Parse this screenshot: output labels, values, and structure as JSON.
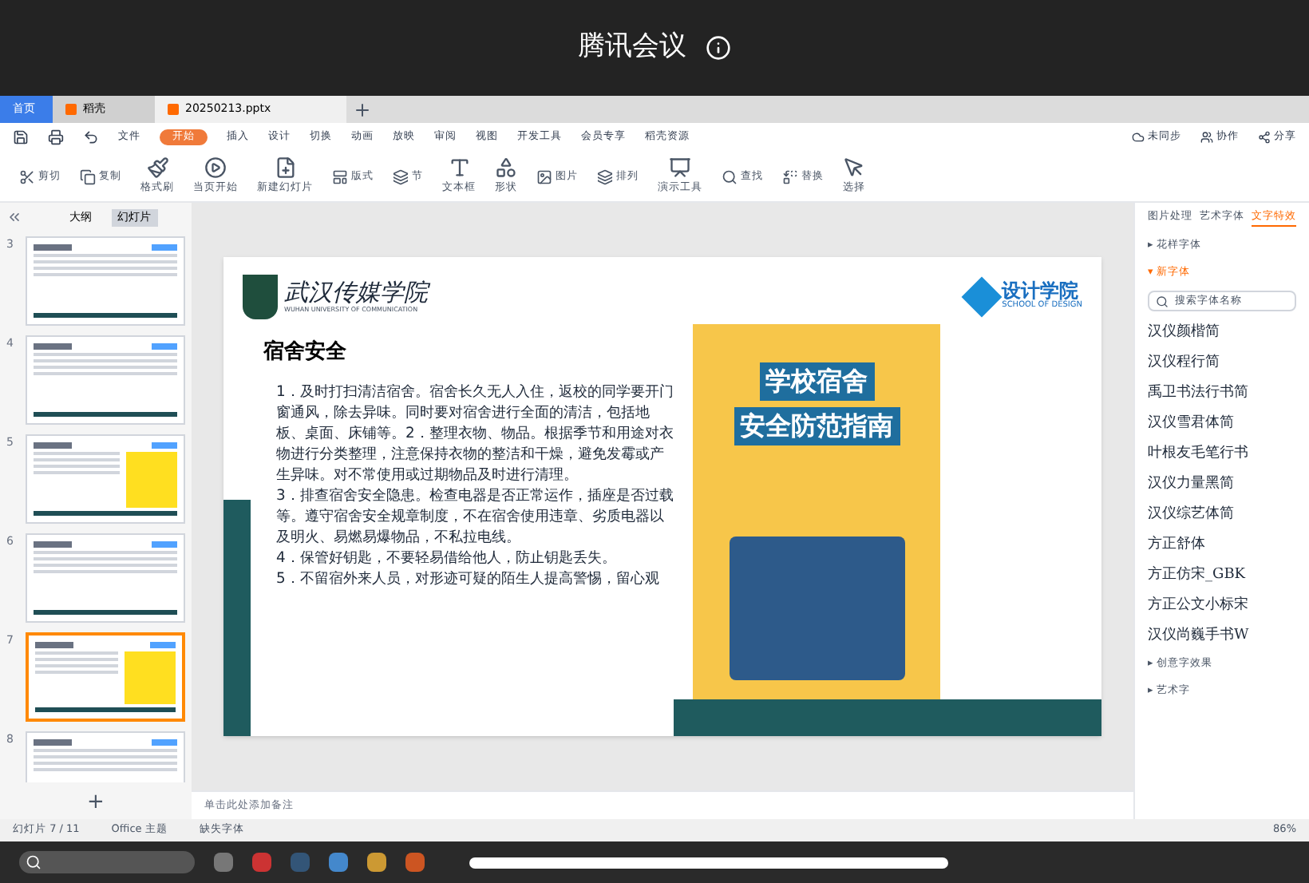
{
  "meeting": {
    "title": "腾讯会议"
  },
  "tabs": [
    {
      "label": "首页",
      "kind": "home",
      "selected": false
    },
    {
      "label": "稻壳",
      "kind": "doc",
      "selected": false
    },
    {
      "label": "20250213.pptx",
      "kind": "doc",
      "selected": true
    }
  ],
  "menu": [
    {
      "label": "文件",
      "selected": false
    },
    {
      "label": "开始",
      "selected": true
    },
    {
      "label": "插入",
      "selected": false
    },
    {
      "label": "设计",
      "selected": false
    },
    {
      "label": "切换",
      "selected": false
    },
    {
      "label": "动画",
      "selected": false
    },
    {
      "label": "放映",
      "selected": false
    },
    {
      "label": "审阅",
      "selected": false
    },
    {
      "label": "视图",
      "selected": false
    },
    {
      "label": "开发工具",
      "selected": false
    },
    {
      "label": "会员专享",
      "selected": false
    },
    {
      "label": "稻壳资源",
      "selected": false
    }
  ],
  "menu_right": [
    "未同步",
    "协作",
    "分享"
  ],
  "toolbar": [
    {
      "label": "剪切",
      "kind": "small"
    },
    {
      "label": "复制",
      "kind": "small"
    },
    {
      "label": "格式刷",
      "kind": "big"
    },
    {
      "label": "当页开始",
      "kind": "big"
    },
    {
      "label": "新建幻灯片",
      "kind": "big"
    },
    {
      "label": "版式",
      "kind": "small"
    },
    {
      "label": "节",
      "kind": "small"
    },
    {
      "label": "文本框",
      "kind": "big"
    },
    {
      "label": "形状",
      "kind": "big"
    },
    {
      "label": "图片",
      "kind": "small"
    },
    {
      "label": "排列",
      "kind": "small"
    },
    {
      "label": "演示工具",
      "kind": "big"
    },
    {
      "label": "查找",
      "kind": "small"
    },
    {
      "label": "替换",
      "kind": "small"
    },
    {
      "label": "选择",
      "kind": "big"
    }
  ],
  "left_panel": {
    "tabs": [
      {
        "label": "大纲",
        "selected": false
      },
      {
        "label": "幻灯片",
        "selected": true
      }
    ],
    "slides": [
      {
        "number": "3",
        "has_image": false,
        "selected": false
      },
      {
        "number": "4",
        "has_image": false,
        "selected": false
      },
      {
        "number": "5",
        "has_image": true,
        "selected": false
      },
      {
        "number": "6",
        "has_image": false,
        "selected": false
      },
      {
        "number": "7",
        "has_image": true,
        "selected": true
      },
      {
        "number": "8",
        "has_image": false,
        "selected": false
      }
    ],
    "add_label": "+"
  },
  "slide": {
    "school": "武汉传媒学院",
    "school_en": "WUHAN UNIVERSITY OF COMMUNICATION",
    "dept": "设计学院",
    "dept_en": "SCHOOL OF DESIGN",
    "title": "宿舍安全",
    "paragraphs": [
      "1．及时打扫清洁宿舍。宿舍长久无人入住，返校的同学要开门窗通风，除去异味。同时要对宿舍进行全面的清洁，包括地板、桌面、床铺等。2．整理衣物、物品。根据季节和用途对衣物进行分类整理，注意保持衣物的整洁和干燥，避免发霉或产生异味。对不常使用或过期物品及时进行清理。",
      "3．排查宿舍安全隐患。检查电器是否正常运作，插座是否过载等。遵守宿舍安全规章制度，不在宿舍使用违章、劣质电器以及明火、易燃易爆物品，不私拉电线。",
      "4．保管好钥匙，不要轻易借给他人，防止钥匙丢失。",
      "5．不留宿外来人员，对形迹可疑的陌生人提高警惕，留心观"
    ],
    "poster_lines": [
      "学校宿舍",
      "安全防范指南"
    ]
  },
  "notes_placeholder": "单击此处添加备注",
  "right_panel": {
    "tabs": [
      {
        "label": "图片处理",
        "selected": false
      },
      {
        "label": "艺术字体",
        "selected": false
      },
      {
        "label": "文字特效",
        "selected": true
      }
    ],
    "sections": [
      {
        "label": "▸ 花样字体",
        "expanded": false
      },
      {
        "label": "▾ 新字体",
        "expanded": true
      }
    ],
    "search_placeholder": "搜索字体名称",
    "fonts": [
      "汉仪颜楷简",
      "汉仪程行简",
      "禹卫书法行书简",
      "汉仪雪君体简",
      "叶根友毛笔行书",
      "汉仪力量黑简",
      "汉仪综艺体简",
      "方正舒体",
      "方正仿宋_GBK",
      "方正公文小标宋",
      "汉仪尚巍手书W"
    ],
    "bottom_sections": [
      "▸ 创意字效果",
      "▸ 艺术字"
    ]
  },
  "status_bar": {
    "slide_count": "幻灯片 7 / 11",
    "theme": "Office 主题",
    "missing_font": "缺失字体",
    "zoom": "86%"
  }
}
